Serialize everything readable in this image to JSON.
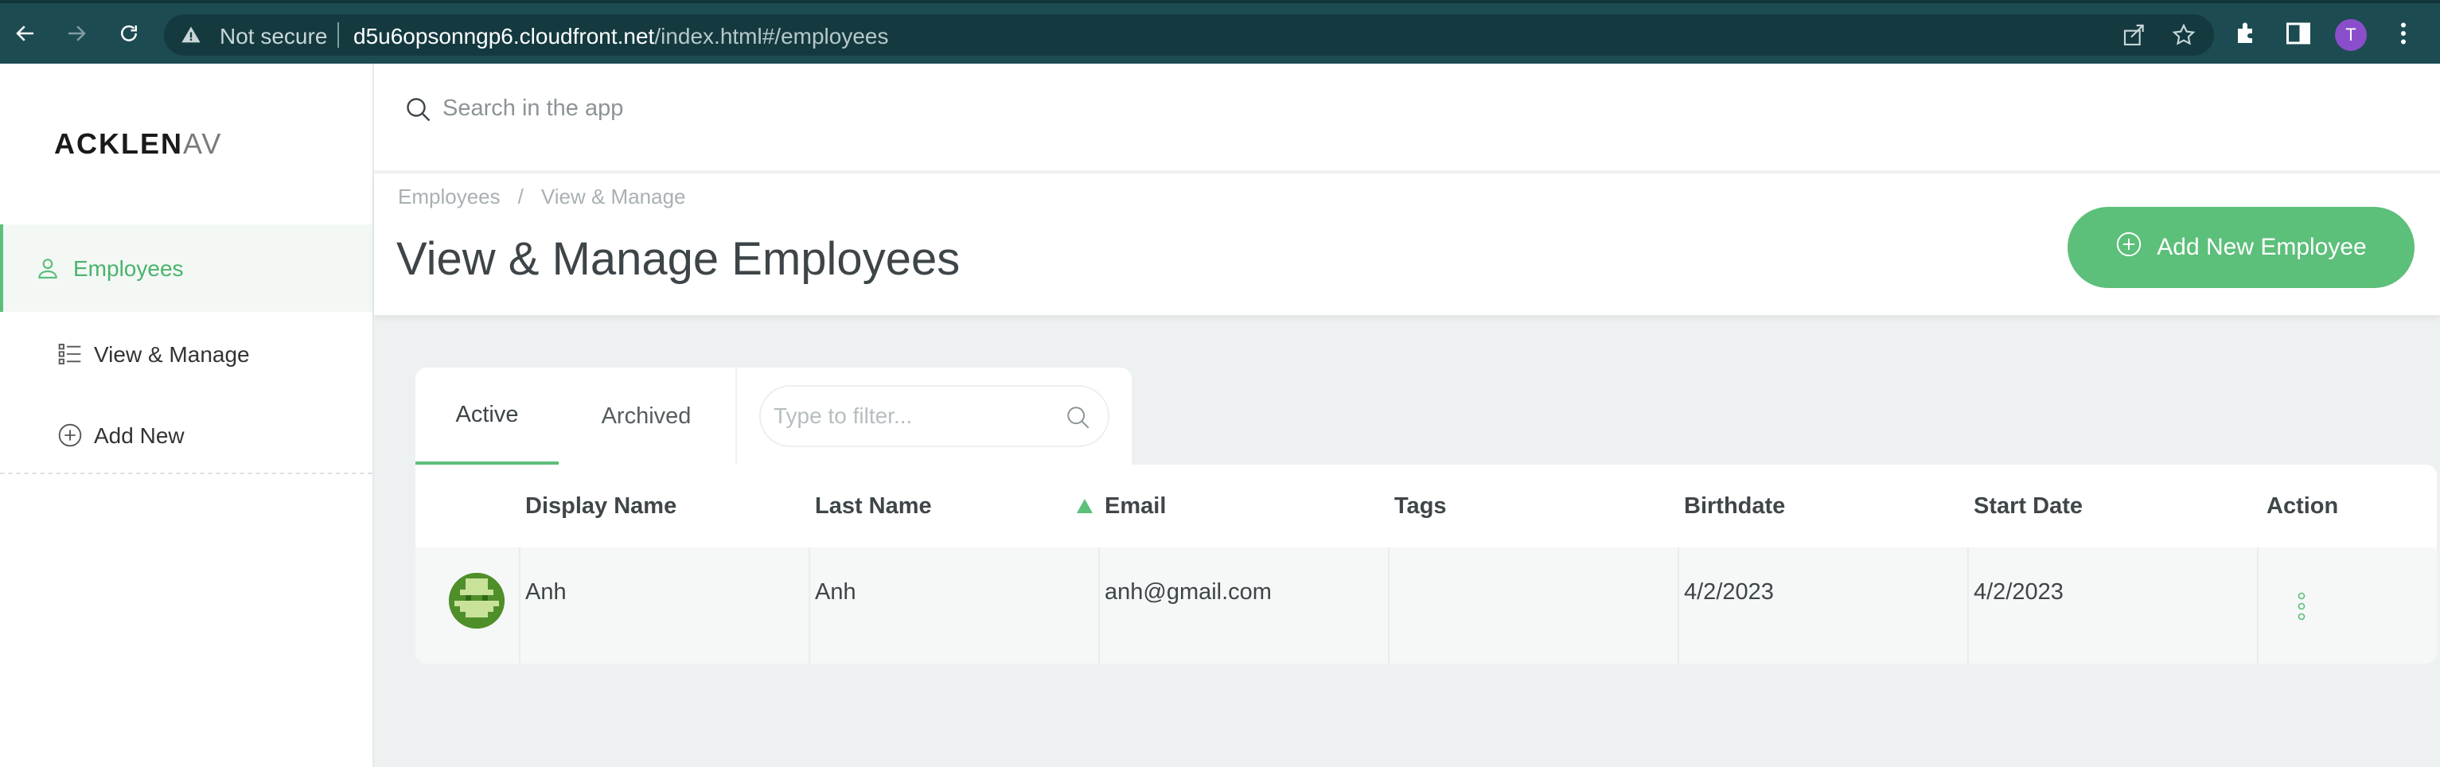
{
  "browser": {
    "not_secure": "Not secure",
    "url_host": "d5u6opsonngp6.cloudfront.net",
    "url_path": "/index.html#/employees",
    "profile_initial": "T"
  },
  "sidebar": {
    "logo_bold": "ACKLEN",
    "logo_fade": "AV",
    "items": [
      {
        "label": "Employees",
        "icon": "user-icon"
      },
      {
        "label": "View & Manage",
        "icon": "list-icon"
      },
      {
        "label": "Add New",
        "icon": "plus-circle-icon"
      }
    ]
  },
  "search": {
    "placeholder": "Search in the app"
  },
  "breadcrumb": {
    "root": "Employees",
    "sep": "/",
    "current": "View & Manage"
  },
  "page": {
    "title": "View & Manage Employees",
    "add_button": "Add New Employee"
  },
  "tabs": [
    {
      "label": "Active"
    },
    {
      "label": "Archived"
    }
  ],
  "filter": {
    "placeholder": "Type to filter..."
  },
  "table": {
    "columns": [
      "Display Name",
      "Last Name",
      "Email",
      "Tags",
      "Birthdate",
      "Start Date",
      "Action"
    ],
    "sorted_column": "Email",
    "rows": [
      {
        "display_name": "Anh",
        "last_name": "Anh",
        "email": "anh@gmail.com",
        "tags": "",
        "birthdate": "4/2/2023",
        "start_date": "4/2/2023"
      }
    ]
  },
  "colors": {
    "accent": "#5cbf7a",
    "chrome": "#1d4b52"
  }
}
